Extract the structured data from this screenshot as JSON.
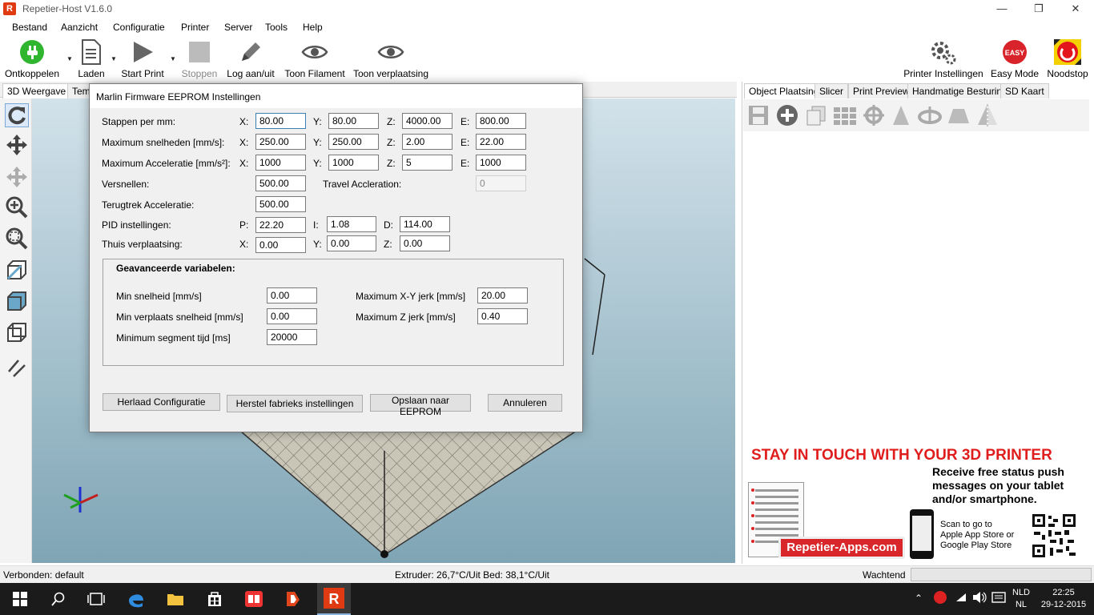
{
  "app": {
    "title": "Repetier-Host V1.6.0"
  },
  "menu": [
    "Bestand",
    "Aanzicht",
    "Configuratie",
    "Printer",
    "Server",
    "Tools",
    "Help"
  ],
  "toolbar": {
    "connect": "Ontkoppelen",
    "load": "Laden",
    "start": "Start Print",
    "stop": "Stoppen",
    "log": "Log aan/uit",
    "filament": "Toon Filament",
    "travel": "Toon verplaatsing",
    "printer_settings": "Printer Instellingen",
    "easy_mode": "Easy Mode",
    "easy_badge": "EASY",
    "emergency": "Noodstop"
  },
  "left_tabs": [
    "3D Weergave",
    "Temp"
  ],
  "right_tabs": [
    "Object Plaatsing",
    "Slicer",
    "Print Preview",
    "Handmatige Besturing",
    "SD Kaart"
  ],
  "ad": {
    "headline": "STAY IN TOUCH WITH YOUR 3D PRINTER",
    "line1": "Receive free status push",
    "line2": "messages on your tablet",
    "line3": "and/or smartphone.",
    "scan1": "Scan to go to",
    "scan2": "Apple App Store or",
    "scan3": "Google Play Store",
    "site": "Repetier-Apps.com"
  },
  "status": {
    "left": "Verbonden: default",
    "center": "Extruder: 26,7°C/Uit Bed: 38,1°C/Uit",
    "right": "Wachtend"
  },
  "taskbar": {
    "lang1": "NLD",
    "lang2": "NL",
    "time": "22:25",
    "date": "29-12-2015"
  },
  "dialog": {
    "title": "Marlin Firmware EEPROM Instellingen",
    "rows": {
      "steps": {
        "label": "Stappen per mm:",
        "x": "80.00",
        "y": "80.00",
        "z": "4000.00",
        "e": "800.00"
      },
      "maxspeed": {
        "label": "Maximum snelheden [mm/s]:",
        "x": "250.00",
        "y": "250.00",
        "z": "2.00",
        "e": "22.00"
      },
      "maxacc": {
        "label": "Maximum Acceleratie [mm/s²]:",
        "x": "1000",
        "y": "1000",
        "z": "5",
        "e": "1000"
      },
      "accel": {
        "label": "Versnellen:",
        "value": "500.00",
        "travel_label": "Travel Accleration:",
        "travel_value": "0"
      },
      "retract": {
        "label": "Terugtrek Acceleratie:",
        "value": "500.00"
      },
      "pid": {
        "label": "PID instellingen:",
        "p": "22.20",
        "i": "1.08",
        "d": "114.00"
      },
      "home": {
        "label": "Thuis verplaatsing:",
        "x": "0.00",
        "y": "0.00",
        "z": "0.00"
      }
    },
    "axis": {
      "x": "X:",
      "y": "Y:",
      "z": "Z:",
      "e": "E:",
      "p": "P:",
      "i": "I:",
      "d": "D:"
    },
    "advanced": {
      "title": "Geavanceerde variabelen:",
      "min_speed_label": "Min snelheid [mm/s]",
      "min_speed": "0.00",
      "min_travel_label": "Min verplaats snelheid [mm/s]",
      "min_travel": "0.00",
      "min_segment_label": "Minimum segment tijd [ms]",
      "min_segment": "20000",
      "max_xy_jerk_label": "Maximum X-Y jerk [mm/s]",
      "max_xy_jerk": "20.00",
      "max_z_jerk_label": "Maximum Z jerk [mm/s]",
      "max_z_jerk": "0.40"
    },
    "buttons": {
      "reload": "Herlaad Configuratie",
      "factory": "Herstel fabrieks instellingen",
      "save": "Opslaan naar EEPROM",
      "cancel": "Annuleren"
    }
  }
}
